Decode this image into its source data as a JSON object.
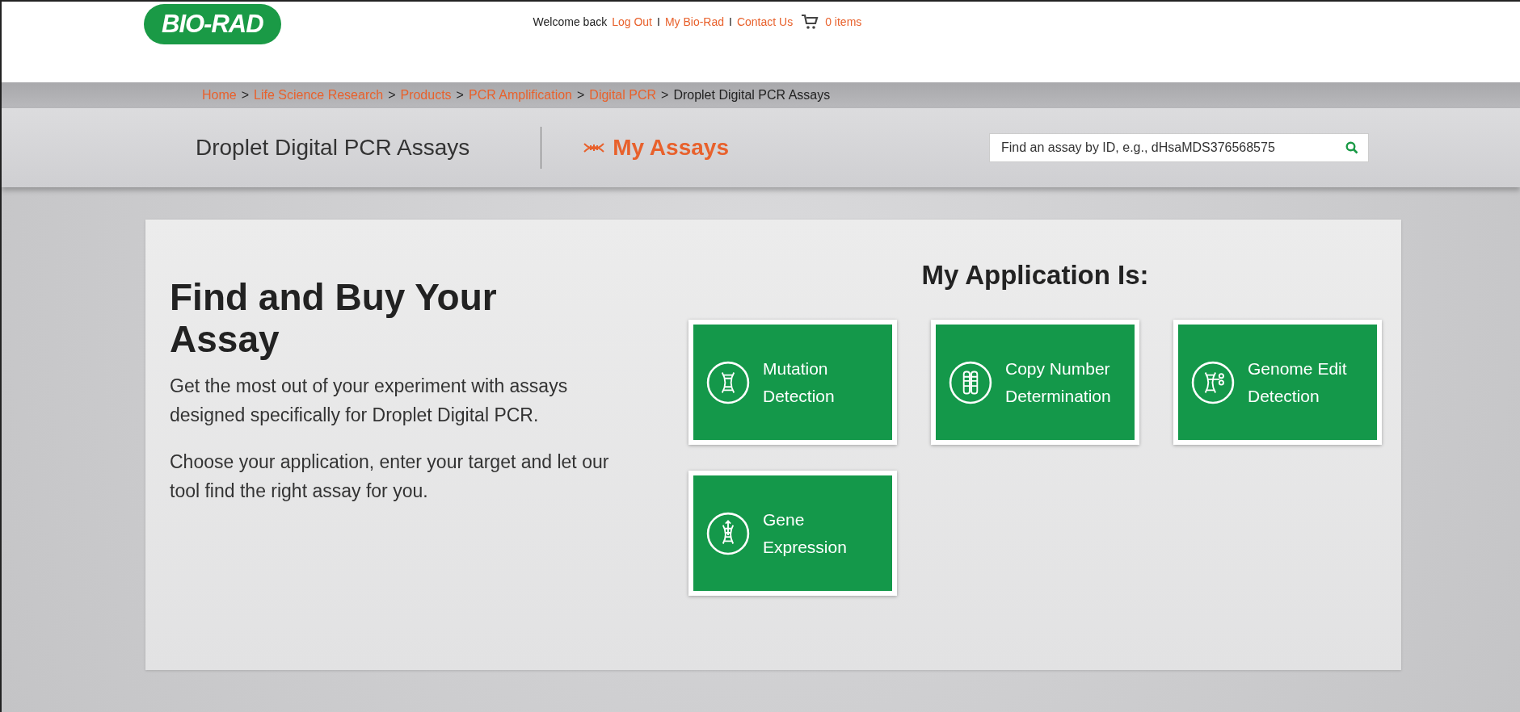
{
  "header": {
    "logo": "BIO-RAD",
    "welcome": "Welcome back",
    "links": [
      {
        "label": "Log Out"
      },
      {
        "separator": "I",
        "label": "My Bio-Rad"
      },
      {
        "separator": "I",
        "label": "Contact Us"
      }
    ],
    "cart": "0 items"
  },
  "breadcrumb": {
    "links": [
      {
        "label": "Home",
        "separator": ">"
      },
      {
        "label": "Life Science Research",
        "separator": ">"
      },
      {
        "label": "Products",
        "separator": ">"
      },
      {
        "label": "PCR Amplification",
        "separator": ">"
      },
      {
        "label": "Digital PCR",
        "separator": ">"
      }
    ],
    "current": "Droplet Digital PCR Assays"
  },
  "subheader": {
    "title": "Droplet Digital PCR Assays",
    "my_assays": "My Assays",
    "search": {
      "placeholder": "Find an assay by ID, e.g., dHsaMDS376568575"
    }
  },
  "intro": {
    "heading": "Find and Buy Your Assay",
    "paragraphs": [
      "Get the most out of your experiment with assays designed specifically for Droplet Digital PCR.",
      "Choose your application, enter your target and let our tool find the right assay for you."
    ]
  },
  "applications": {
    "title": "My Application Is:",
    "tiles": [
      {
        "kind": "mutation",
        "lines": [
          "Mutation",
          "Detection"
        ]
      },
      {
        "kind": "copy-number",
        "lines": [
          "Copy Number",
          "Determination"
        ]
      },
      {
        "kind": "genome-edit",
        "lines": [
          "Genome Edit",
          "Detection"
        ]
      },
      {
        "kind": "expression",
        "lines": [
          "Gene",
          "Expression"
        ]
      }
    ]
  }
}
